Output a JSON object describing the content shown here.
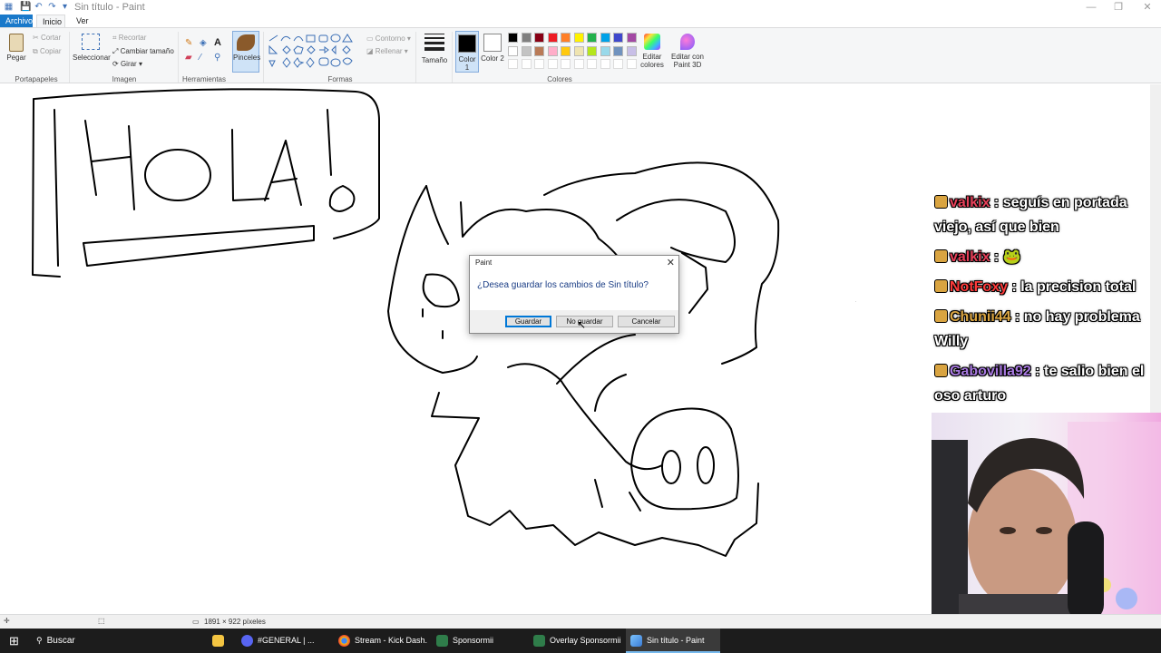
{
  "window": {
    "title": "Sin título - Paint",
    "controls": [
      "—",
      "❐",
      "✕"
    ]
  },
  "menu": {
    "tabs": [
      "Archivo",
      "Inicio",
      "Ver"
    ]
  },
  "ribbon": {
    "portapapeles": {
      "group": "Portapapeles",
      "pegar": "Pegar",
      "cortar": "Cortar",
      "copiar": "Copiar"
    },
    "imagen": {
      "group": "Imagen",
      "seleccionar": "Seleccionar",
      "recortar": "Recortar",
      "cambiar_tamano": "Cambiar tamaño",
      "girar": "Girar"
    },
    "herramientas": {
      "group": "Herramientas",
      "pinceles": "Pinceles"
    },
    "formas": {
      "group": "Formas",
      "contorno": "Contorno",
      "rellenar": "Rellenar"
    },
    "tamano": "Tamaño",
    "color1": "Color 1",
    "color2": "Color 2",
    "colores": {
      "group": "Colores",
      "editar": "Editar colores",
      "paint3d": "Editar con Paint 3D"
    },
    "palette_row1": [
      "#000000",
      "#7f7f7f",
      "#880015",
      "#ed1c24",
      "#ff7f27",
      "#fff200",
      "#22b14c",
      "#00a2e8",
      "#3f48cc",
      "#a349a4"
    ],
    "palette_row2": [
      "#ffffff",
      "#c3c3c3",
      "#b97a57",
      "#ffaec9",
      "#ffc90e",
      "#efe4b0",
      "#b5e61d",
      "#99d9ea",
      "#7092be",
      "#c8bfe7"
    ]
  },
  "status": {
    "dimensions": "1891 × 922 píxeles"
  },
  "dialog": {
    "title": "Paint",
    "message": "¿Desea guardar los cambios de Sin título?",
    "save": "Guardar",
    "dont_save": "No guardar",
    "cancel": "Cancelar"
  },
  "taskbar": {
    "search": "Buscar",
    "items": [
      "#GENERAL | ...",
      "Stream - Kick Dash...",
      "Sponsormii",
      "Overlay Sponsormii",
      "Sin título - Paint"
    ]
  },
  "chat": [
    {
      "user": "valkix",
      "user_color": "#e8405a",
      "text": ": seguís en portada viejo, así que bien"
    },
    {
      "user": "valkix",
      "user_color": "#e8405a",
      "text": ": 🐸"
    },
    {
      "user": "NotFoxy",
      "user_color": "#ff3b3b",
      "text": ": la precision total"
    },
    {
      "user": "Chunii44",
      "user_color": "#d9a441",
      "text": ": no hay problema Willy"
    },
    {
      "user": "Gabovilla92",
      "user_color": "#a879e0",
      "text": ": te salio bien el oso arturo"
    }
  ],
  "drawing": {
    "text": "HOLA!"
  }
}
